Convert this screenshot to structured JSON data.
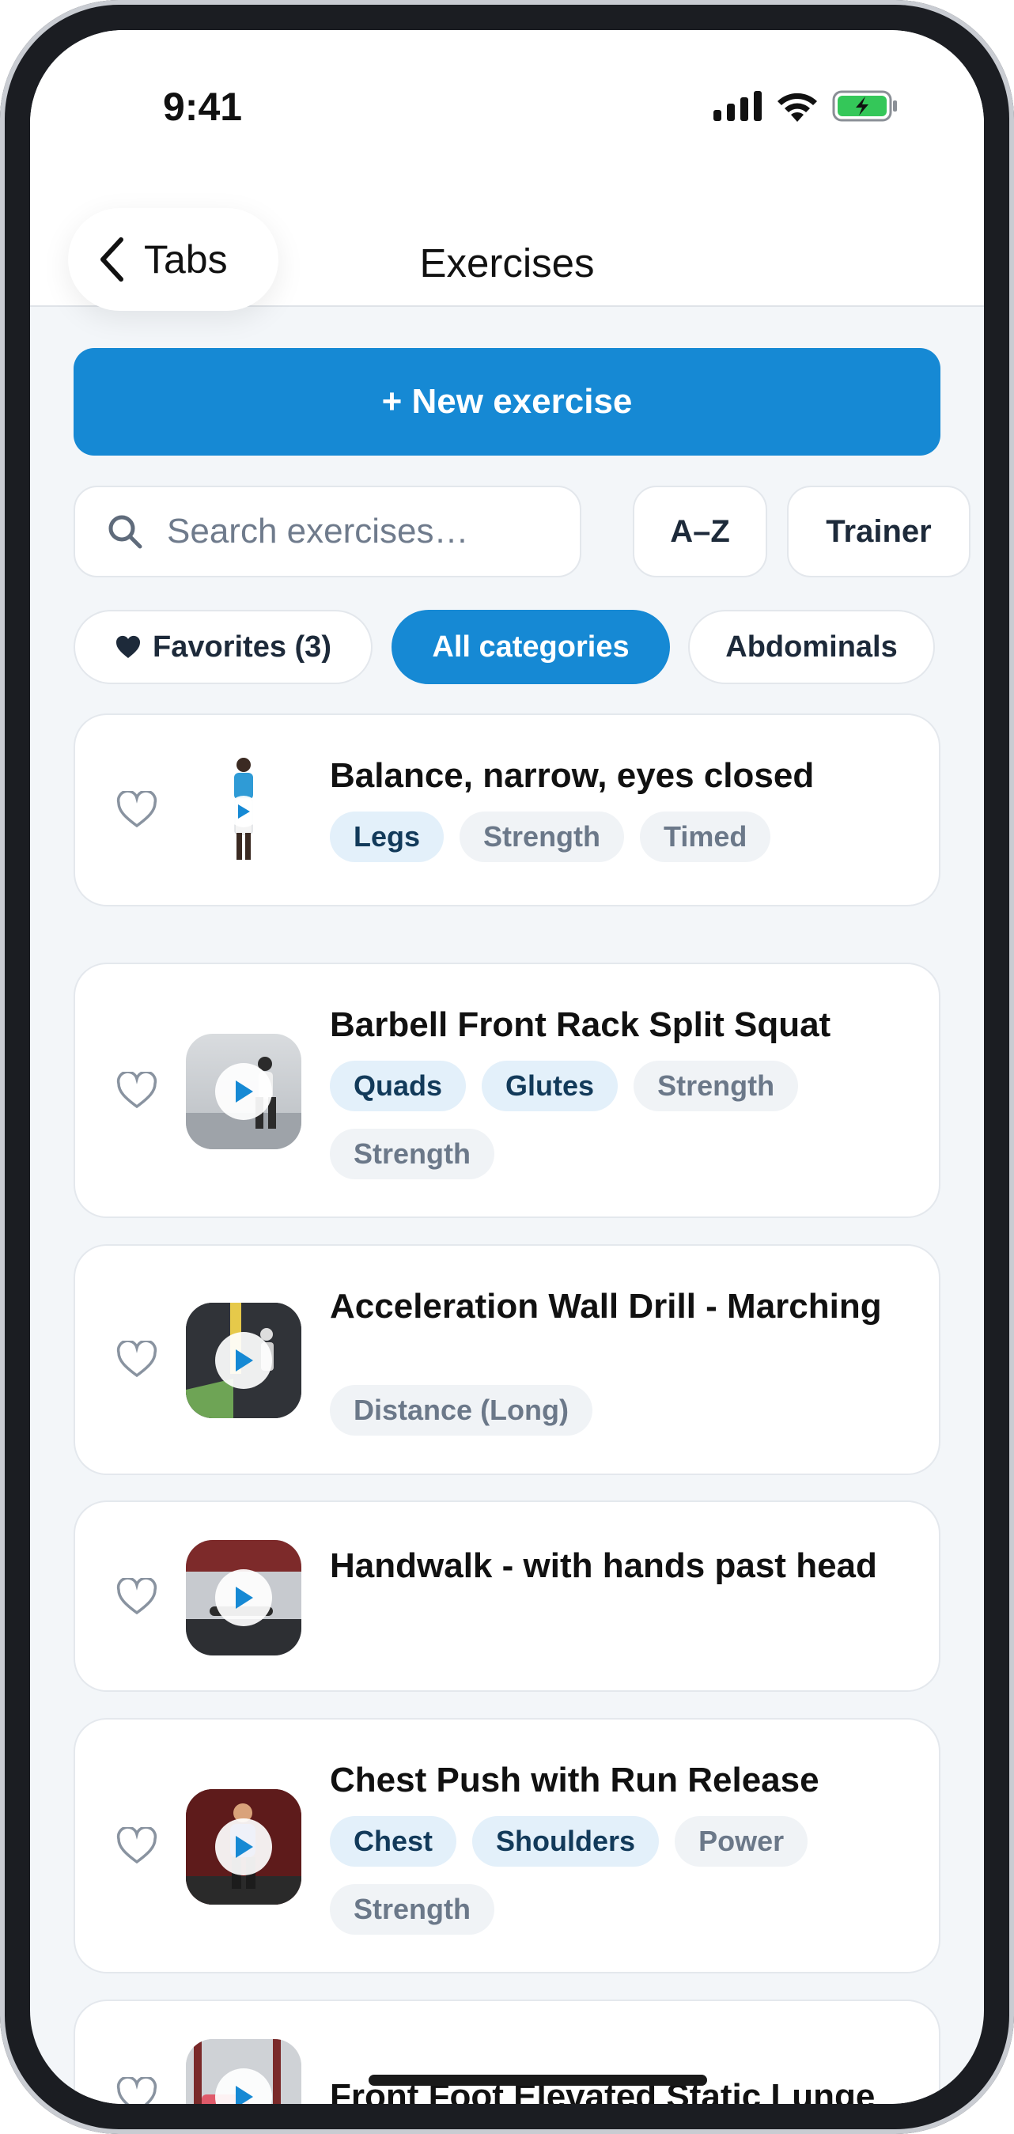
{
  "status_bar": {
    "time": "9:41",
    "icons": [
      "signal-icon",
      "wifi-icon",
      "battery-charging-icon"
    ]
  },
  "nav": {
    "back_label": "Tabs",
    "title": "Exercises"
  },
  "actions": {
    "new_exercise_label": "+ New exercise"
  },
  "search": {
    "placeholder": "Search exercises…"
  },
  "sort": {
    "az_label": "A–Z",
    "trainer_label": "Trainer"
  },
  "filters": {
    "favorites_label": "Favorites (3)",
    "all_categories_label": "All categories",
    "abdominals_label": "Abdominals"
  },
  "colors": {
    "accent": "#1689d4",
    "background": "#f3f6f9",
    "muscle_tag_bg": "#e3f0fa",
    "type_tag_bg": "#f0f3f6"
  },
  "exercises": [
    {
      "title": "Balance, narrow, eyes closed",
      "muscles": [
        "Legs"
      ],
      "types": [
        "Strength",
        "Timed"
      ]
    },
    {
      "title": "Barbell Front Rack Split Squat",
      "muscles": [
        "Quads",
        "Glutes"
      ],
      "types": [
        "Strength",
        "Strength"
      ]
    },
    {
      "title": "Acceleration Wall Drill - Marching",
      "muscles": [],
      "types": [
        "Distance (Long)"
      ]
    },
    {
      "title": "Handwalk - with hands past head",
      "muscles": [],
      "types": []
    },
    {
      "title": "Chest Push with Run Release",
      "muscles": [
        "Chest",
        "Shoulders"
      ],
      "types": [
        "Power",
        "Strength"
      ]
    },
    {
      "title": "Front Foot Elevated Static Lunge",
      "muscles": [],
      "types": []
    }
  ]
}
